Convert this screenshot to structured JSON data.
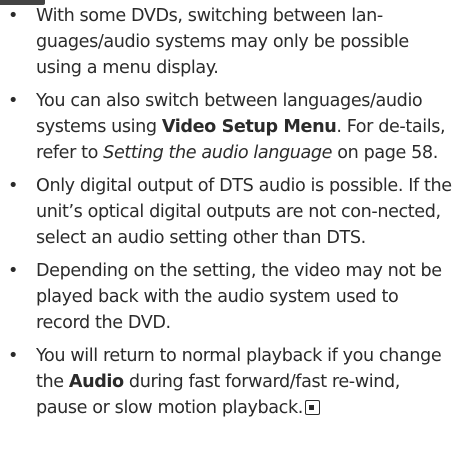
{
  "bullet_char": "•",
  "notes": [
    {
      "text": "With some DVDs, switching between lan-guages/audio systems may only be possible using a menu display."
    },
    {
      "pre": "You can also switch between languages/audio systems using ",
      "bold": "Video Setup Menu",
      "mid": ". For de-tails, refer to ",
      "italic": "Setting the audio language",
      "post": " on page 58."
    },
    {
      "text": "Only digital output of DTS audio is possible. If the unit’s optical digital outputs are not con-nected, select an audio setting other than DTS."
    },
    {
      "text": "Depending on the setting, the video may not be played back with the audio system used to record the DVD."
    },
    {
      "pre": "You will return to normal playback if you change the ",
      "bold": "Audio",
      "post": " during fast forward/fast re-wind, pause or slow motion playback."
    }
  ],
  "end_mark_icon": "stop-square-icon"
}
